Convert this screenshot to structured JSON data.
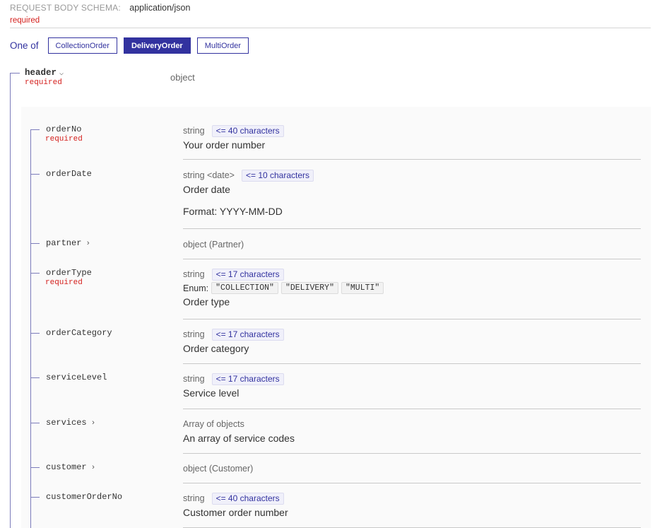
{
  "schema": {
    "label": "REQUEST BODY SCHEMA:",
    "content_type": "application/json",
    "required_label": "required"
  },
  "one_of": {
    "label": "One of",
    "options": [
      "CollectionOrder",
      "DeliveryOrder",
      "MultiOrder"
    ],
    "selected": "DeliveryOrder"
  },
  "header_prop": {
    "name": "header",
    "required_label": "required",
    "type": "object"
  },
  "properties": [
    {
      "name": "orderNo",
      "required_label": "required",
      "type": "string",
      "constraint": "<= 40 characters",
      "description": "Your order number"
    },
    {
      "name": "orderDate",
      "type": "string <date>",
      "constraint": "<= 10 characters",
      "description": "Order date",
      "format": "Format: YYYY-MM-DD"
    },
    {
      "name": "partner",
      "expandable": true,
      "type": "object (Partner)"
    },
    {
      "name": "orderType",
      "required_label": "required",
      "type": "string",
      "constraint": "<= 17 characters",
      "enum_label": "Enum:",
      "enum_values": [
        "\"COLLECTION\"",
        "\"DELIVERY\"",
        "\"MULTI\""
      ],
      "description": "Order type"
    },
    {
      "name": "orderCategory",
      "type": "string",
      "constraint": "<= 17 characters",
      "description": "Order category"
    },
    {
      "name": "serviceLevel",
      "type": "string",
      "constraint": "<= 17 characters",
      "description": "Service level"
    },
    {
      "name": "services",
      "expandable": true,
      "type": "Array of objects",
      "description": "An array of service codes"
    },
    {
      "name": "customer",
      "expandable": true,
      "type": "object (Customer)"
    },
    {
      "name": "customerOrderNo",
      "type": "string",
      "constraint": "<= 40 characters",
      "description": "Customer order number"
    }
  ],
  "icons": {
    "expand_down": "chevron-down-icon",
    "expand_right": "chevron-right-icon"
  },
  "colors": {
    "accent": "#32329f",
    "required": "#d41f1c",
    "panel_bg": "#fafafa"
  }
}
